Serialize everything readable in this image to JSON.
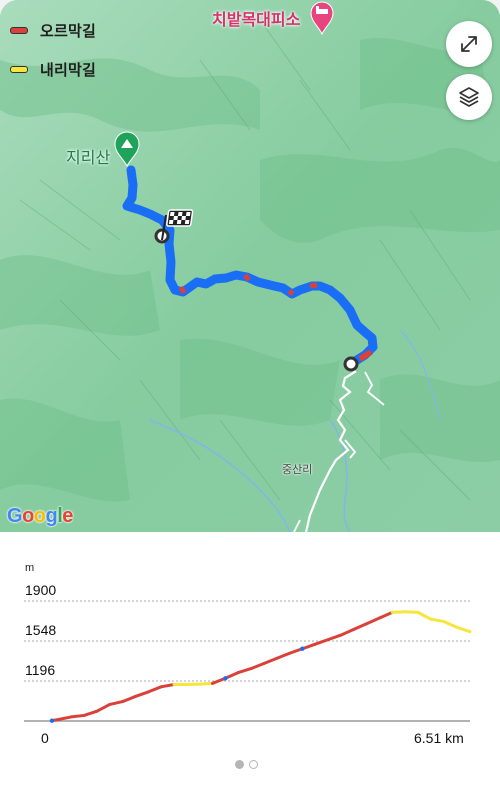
{
  "legend": {
    "uphill": {
      "label": "오르막길",
      "color": "#d9413a"
    },
    "downhill": {
      "label": "내리막길",
      "color": "#f5e63d"
    }
  },
  "map": {
    "poi_shelter": "치밭목대피소",
    "poi_mountain": "지리산",
    "village": "중산리",
    "attribution": [
      "G",
      "o",
      "o",
      "g",
      "l",
      "e"
    ],
    "route_color": "#1a6ef5"
  },
  "buttons": {
    "expand_icon": "expand-arrows-icon",
    "layers_icon": "layers-icon"
  },
  "chart_data": {
    "type": "line",
    "title": "",
    "xlabel": "",
    "ylabel": "m",
    "x_tick_labels": [
      "0",
      "6.51 km"
    ],
    "y_tick_labels": [
      "1900",
      "1548",
      "1196"
    ],
    "xlim": [
      0,
      6.51
    ],
    "ylim": [
      844,
      1900
    ],
    "x": [
      0.0,
      0.1,
      0.3,
      0.5,
      0.7,
      0.9,
      1.1,
      1.3,
      1.5,
      1.7,
      1.9,
      2.1,
      2.3,
      2.5,
      2.7,
      2.9,
      3.1,
      3.3,
      3.5,
      3.7,
      3.9,
      4.1,
      4.3,
      4.5,
      4.7,
      4.9,
      5.1,
      5.3,
      5.5,
      5.7,
      5.9,
      6.1,
      6.3,
      6.51
    ],
    "y": [
      847,
      857,
      880,
      893,
      930,
      990,
      1015,
      1060,
      1100,
      1145,
      1165,
      1165,
      1168,
      1175,
      1220,
      1270,
      1305,
      1350,
      1395,
      1440,
      1480,
      1520,
      1560,
      1600,
      1650,
      1700,
      1750,
      1800,
      1805,
      1800,
      1740,
      1720,
      1670,
      1630
    ]
  },
  "pager": {
    "active_color": "#b5b5b5"
  }
}
